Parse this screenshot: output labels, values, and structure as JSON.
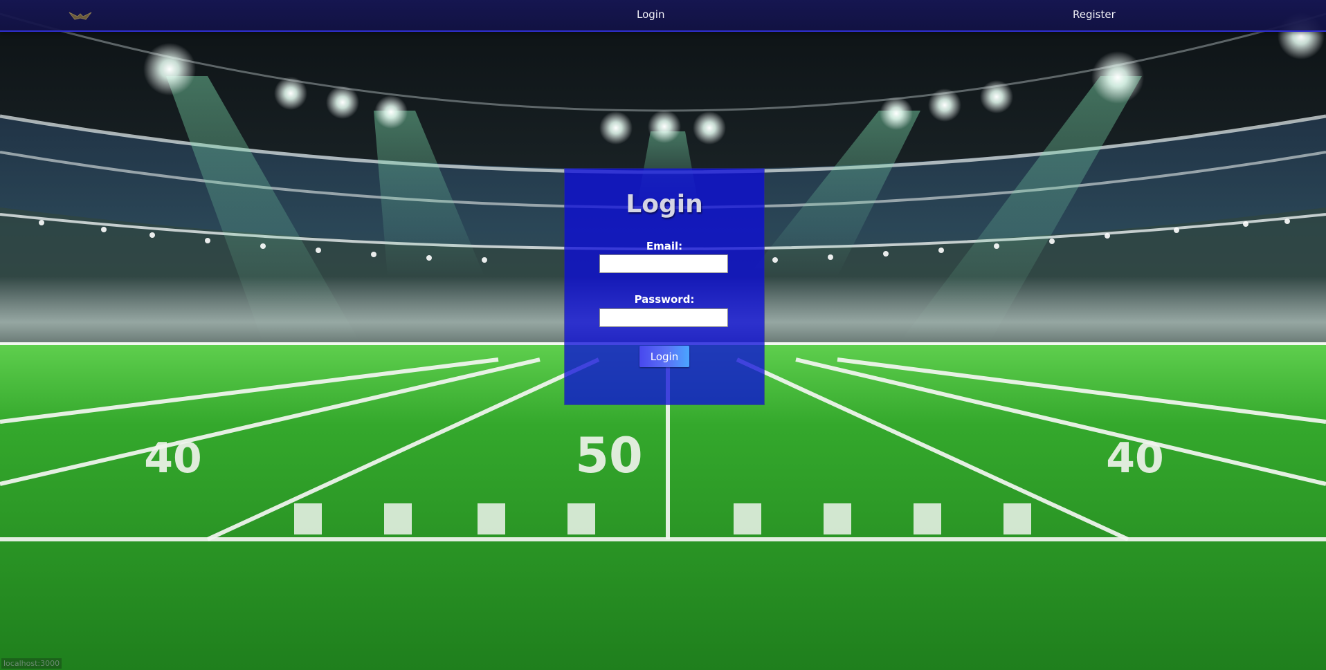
{
  "nav": {
    "logo_icon": "eagle-logo-icon",
    "login_label": "Login",
    "register_label": "Register"
  },
  "login_form": {
    "title": "Login",
    "email_label": "Email:",
    "email_value": "",
    "password_label": "Password:",
    "password_value": "",
    "submit_label": "Login"
  },
  "status_bar": {
    "url": "localhost:3000"
  },
  "background": {
    "subject": "football-stadium-at-night",
    "yard_numbers": [
      "40",
      "50",
      "40"
    ]
  },
  "colors": {
    "navbar": "#161654",
    "panel": "#0c0cda",
    "button_start": "#4848ee",
    "button_end": "#4aa6ff",
    "turf": "#2f9e2a"
  }
}
